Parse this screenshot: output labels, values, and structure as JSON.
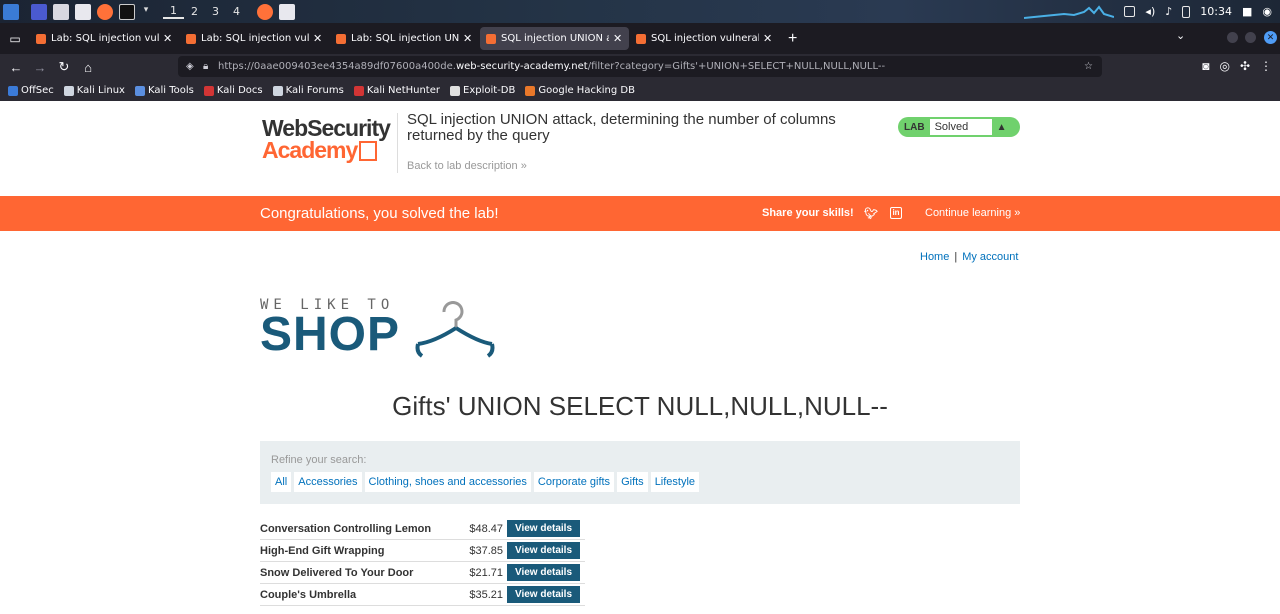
{
  "taskbar": {
    "workspaces": [
      "1",
      "2",
      "3",
      "4"
    ],
    "clock": "10:34"
  },
  "browser": {
    "tabs": [
      {
        "title": "Lab: SQL injection vulnera"
      },
      {
        "title": "Lab: SQL injection vulnera"
      },
      {
        "title": "Lab: SQL injection UNION"
      },
      {
        "title": "SQL injection UNION atta"
      },
      {
        "title": "SQL injection vulnerabilit"
      }
    ],
    "url_prefix": "https://0aae009403ee4354a89df07600a400de.",
    "url_host": "web-security-academy.net",
    "url_path": "/filter?category=Gifts'+UNION+SELECT+NULL,NULL,NULL--",
    "bookmarks": [
      "OffSec",
      "Kali Linux",
      "Kali Tools",
      "Kali Docs",
      "Kali Forums",
      "Kali NetHunter",
      "Exploit-DB",
      "Google Hacking DB"
    ]
  },
  "header": {
    "logo_line1": "WebSecurity",
    "logo_line2": "Academy",
    "lab_title": "SQL injection UNION attack, determining the number of columns returned by the query",
    "back_link": "Back to lab description »",
    "badge_label": "LAB",
    "badge_status": "Solved"
  },
  "banner": {
    "message": "Congratulations, you solved the lab!",
    "share": "Share your skills!",
    "continue": "Continue learning »"
  },
  "nav": {
    "home": "Home",
    "sep": "|",
    "account": "My account"
  },
  "shop": {
    "tagline": "WE LIKE TO",
    "name": "SHOP"
  },
  "main": {
    "heading": "Gifts' UNION SELECT NULL,NULL,NULL--",
    "refine_label": "Refine your search:",
    "filters": [
      "All",
      "Accessories",
      "Clothing, shoes and accessories",
      "Corporate gifts",
      "Gifts",
      "Lifestyle"
    ],
    "view_label": "View details",
    "products": [
      {
        "name": "Conversation Controlling Lemon",
        "price": "$48.47"
      },
      {
        "name": "High-End Gift Wrapping",
        "price": "$37.85"
      },
      {
        "name": "Snow Delivered To Your Door",
        "price": "$21.71"
      },
      {
        "name": "Couple's Umbrella",
        "price": "$35.21"
      }
    ]
  }
}
